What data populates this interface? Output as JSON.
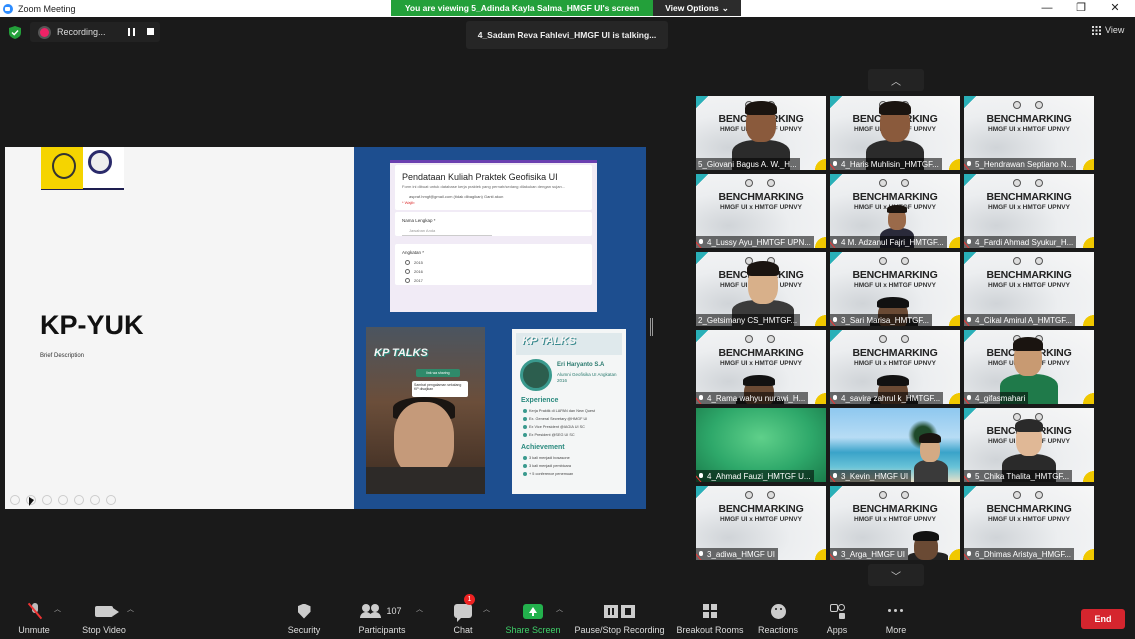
{
  "window": {
    "title": "Zoom Meeting",
    "controls": {
      "minimize": "—",
      "restore": "❐",
      "close": "✕"
    }
  },
  "banner": {
    "viewing_text": "You are viewing 5_Adinda Kayla Salma_HMGF UI's screen",
    "view_options_label": "View Options",
    "accent": "#23a03a"
  },
  "recording": {
    "label": "Recording..."
  },
  "talking_indicator": "4_Sadam Reva Fahlevi_HMGF UI is talking...",
  "view_button_label": "View",
  "shared_screen": {
    "slide_title": "KP-YUK",
    "slide_subtitle": "Brief Description",
    "form": {
      "title": "Pendataan Kuliah Praktek Geofisika UI",
      "description": "Form ini dibuat untuk database kerja praktek yang pernah/sedang dilakukan dengan sujan...",
      "email_line": "aspraf.hmgf@gmail.com (tidak dibagikan) Ganti akun",
      "required_note": "* Wajib",
      "q1_label": "Nama Lengkap *",
      "q1_placeholder": "Jawaban Anda",
      "q2_label": "Angkatan *",
      "options": [
        "2015",
        "2016",
        "2017"
      ]
    },
    "story": {
      "header": "KP TALKS",
      "pill": "link wa sharing",
      "note": "Sambat pengalaman sekalang KP disajikan"
    },
    "poster": {
      "header": "KP TALKS",
      "name": "Eri Haryanto S.A",
      "subtitle": "Alumni Geofisika UI Angkatan 2016",
      "experience_title": "Experience",
      "experience": [
        "Kerja Praktik di LAPAN dan New Quest",
        "Ex. General Secretary @HMGF UI",
        "Ex Vice President @IAGIA UI SC",
        "Ex President @SEG UI SC"
      ],
      "achievement_title": "Achievement",
      "achievement": [
        "3 kali menjadi bosasone",
        "3 kali menjadi pembicara",
        "+ 5 conference penemuan"
      ]
    }
  },
  "gallery": {
    "tiles": [
      {
        "name": "5_Giovani Bagus A. W._H...",
        "muted": false,
        "bg": "bm",
        "person": "male-dark"
      },
      {
        "name": "4_Haris Muhlisin_HMTGF...",
        "muted": true,
        "bg": "bm",
        "person": "male-dark"
      },
      {
        "name": "5_Hendrawan Septiano N...",
        "muted": true,
        "bg": "bm",
        "person": null
      },
      {
        "name": "4_Lussy Ayu_HMTGF UPN...",
        "muted": true,
        "bg": "bm",
        "person": null
      },
      {
        "name": "4 M. Adzanul Fajri_HMTGF...",
        "muted": true,
        "bg": "bm",
        "person": "small"
      },
      {
        "name": "4_Fardi Ahmad Syukur_H...",
        "muted": true,
        "bg": "bm",
        "person": null
      },
      {
        "name": "2_Getsimany CS_HMTGF...",
        "muted": false,
        "bg": "bm",
        "person": "female"
      },
      {
        "name": "3_Sari Marisa_HMTGF...",
        "muted": true,
        "bg": "bm",
        "person": "bottom"
      },
      {
        "name": "4_Cikal Amirul A_HMTGF...",
        "muted": true,
        "bg": "bm",
        "person": null
      },
      {
        "name": "4_Rama wahyu nurawi_H...",
        "muted": true,
        "bg": "bm",
        "person": "bottom"
      },
      {
        "name": "4_savira zahrul k_HMTGF...",
        "muted": true,
        "bg": "bm",
        "person": "bottom"
      },
      {
        "name": "4_gifasmahari",
        "muted": true,
        "bg": "bm",
        "person": "female-green"
      },
      {
        "name": "4_Ahmad Fauzi_HMTGF U...",
        "muted": true,
        "bg": "green",
        "person": null
      },
      {
        "name": "3_Kevin_HMGF UI",
        "muted": true,
        "bg": "beach",
        "person": "small-right"
      },
      {
        "name": "5_Chika Thalita_HMTGF...",
        "muted": true,
        "bg": "bm",
        "person": "female-hijab"
      },
      {
        "name": "3_adiwa_HMGF UI",
        "muted": true,
        "bg": "bm",
        "person": null
      },
      {
        "name": "3_Arga_HMGF UI",
        "muted": true,
        "bg": "bm",
        "person": "bottom-right"
      },
      {
        "name": "6_Dhimas Aristya_HMGF...",
        "muted": true,
        "bg": "bm",
        "person": null
      }
    ],
    "bg_title": "BENCHMARKING",
    "bg_subtitle": "HMGF UI x HMTGF UPNVY"
  },
  "toolbar": {
    "unmute": "Unmute",
    "stop_video": "Stop Video",
    "security": "Security",
    "participants": "Participants",
    "participants_count": "107",
    "chat": "Chat",
    "chat_badge": "1",
    "share_screen": "Share Screen",
    "pause_stop_recording": "Pause/Stop Recording",
    "breakout_rooms": "Breakout Rooms",
    "reactions": "Reactions",
    "apps": "Apps",
    "more": "More",
    "end": "End",
    "end_color": "#d5252e"
  }
}
